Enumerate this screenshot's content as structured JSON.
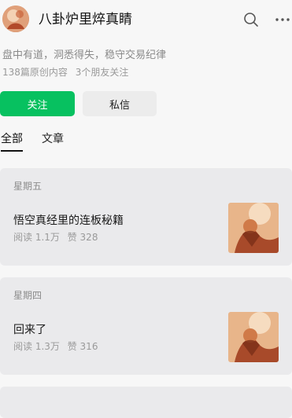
{
  "profile": {
    "name": "八卦炉里焠真睛",
    "bio": "盘中有道，洞悉得失，稳守交易纪律",
    "stats": {
      "articles": "138篇原创内容",
      "friends": "3个朋友关注"
    }
  },
  "actions": {
    "follow_label": "关注",
    "message_label": "私信"
  },
  "tabs": [
    {
      "label": "全部",
      "active": true
    },
    {
      "label": "文章",
      "active": false
    }
  ],
  "posts": [
    {
      "day": "星期五",
      "title": "悟空真经里的连板秘籍",
      "reads": "阅读 1.1万",
      "likes": "赞 328"
    },
    {
      "day": "星期四",
      "title": "回来了",
      "reads": "阅读 1.3万",
      "likes": "赞 316"
    }
  ],
  "colors": {
    "accent": "#07c160",
    "card_bg": "#eaeaec",
    "page_bg": "#f7f7f7"
  }
}
